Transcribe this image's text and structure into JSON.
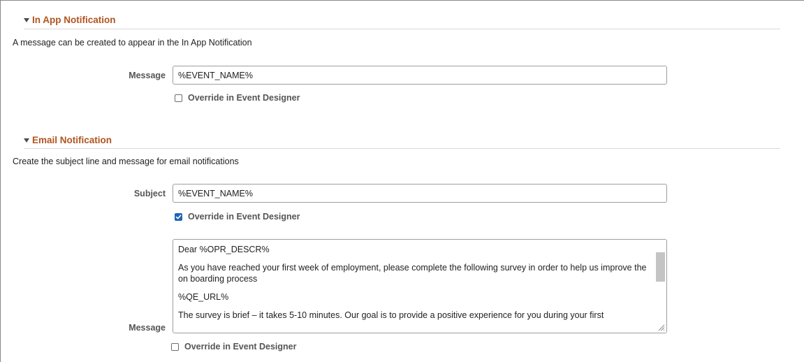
{
  "in_app": {
    "title": "In App Notification",
    "description": "A message can be created to appear in the In App Notification",
    "message_label": "Message",
    "message_value": "%EVENT_NAME%",
    "override_label": "Override in Event Designer",
    "override_checked": false
  },
  "email": {
    "title": "Email Notification",
    "description": "Create the subject line and message for email notifications",
    "subject_label": "Subject",
    "subject_value": "%EVENT_NAME%",
    "subject_override_label": "Override in Event Designer",
    "subject_override_checked": true,
    "message_label": "Message",
    "message_paragraphs": [
      "Dear %OPR_DESCR%",
      "As you have reached your first week of employment, please complete the following survey in order to help us improve the on boarding process",
      "%QE_URL%",
      "The survey is brief – it takes 5-10 minutes. Our goal is to provide a positive experience for you during your first"
    ],
    "message_override_label": "Override in Event Designer",
    "message_override_checked": false
  },
  "colors": {
    "section_title": "#b0541f",
    "checkbox_checked": "#1f64b7"
  },
  "icons": {
    "section_toggle": "triangle-down-icon",
    "checked": "check-icon",
    "scroll_up": "chevron-up-icon",
    "scroll_down": "chevron-down-icon",
    "resize": "resize-grip-icon"
  }
}
